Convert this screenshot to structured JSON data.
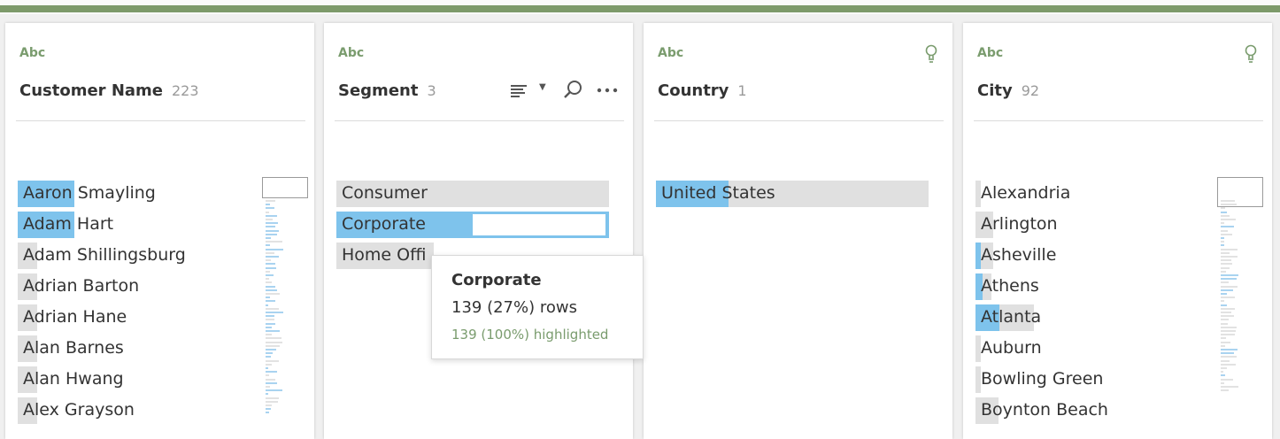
{
  "colors": {
    "accent_green": "#7d9a6a",
    "highlight_blue": "#7ec3ec",
    "bar_gray": "#e0e0e0",
    "type_green": "#7a9c6e"
  },
  "cards": [
    {
      "type_label": "Abc",
      "field": "Customer Name",
      "count": "223",
      "values": [
        "Aaron Smayling",
        "Adam Hart",
        "Adam Shillingsburg",
        "Adrian Barton",
        "Adrian Hane",
        "Alan Barnes",
        "Alan Hwang",
        "Alex Grayson"
      ]
    },
    {
      "type_label": "Abc",
      "field": "Segment",
      "count": "3",
      "values": [
        "Consumer",
        "Corporate",
        "Home Offi"
      ],
      "toolbar_icons": [
        "sort-icon",
        "chevron-down-icon",
        "search-icon",
        "more-options-icon"
      ]
    },
    {
      "type_label": "Abc",
      "field": "Country",
      "count": "1",
      "values": [
        "United States"
      ],
      "recommendation_icon": "lightbulb-icon"
    },
    {
      "type_label": "Abc",
      "field": "City",
      "count": "92",
      "values": [
        "Alexandria",
        "Arlington",
        "Asheville",
        "Athens",
        "Atlanta",
        "Auburn",
        "Bowling Green",
        "Boynton Beach"
      ],
      "recommendation_icon": "lightbulb-icon"
    }
  ],
  "tooltip": {
    "title": "Corporate",
    "rows": "139 (27%) rows",
    "highlighted": "139 (100%) highlighted"
  }
}
